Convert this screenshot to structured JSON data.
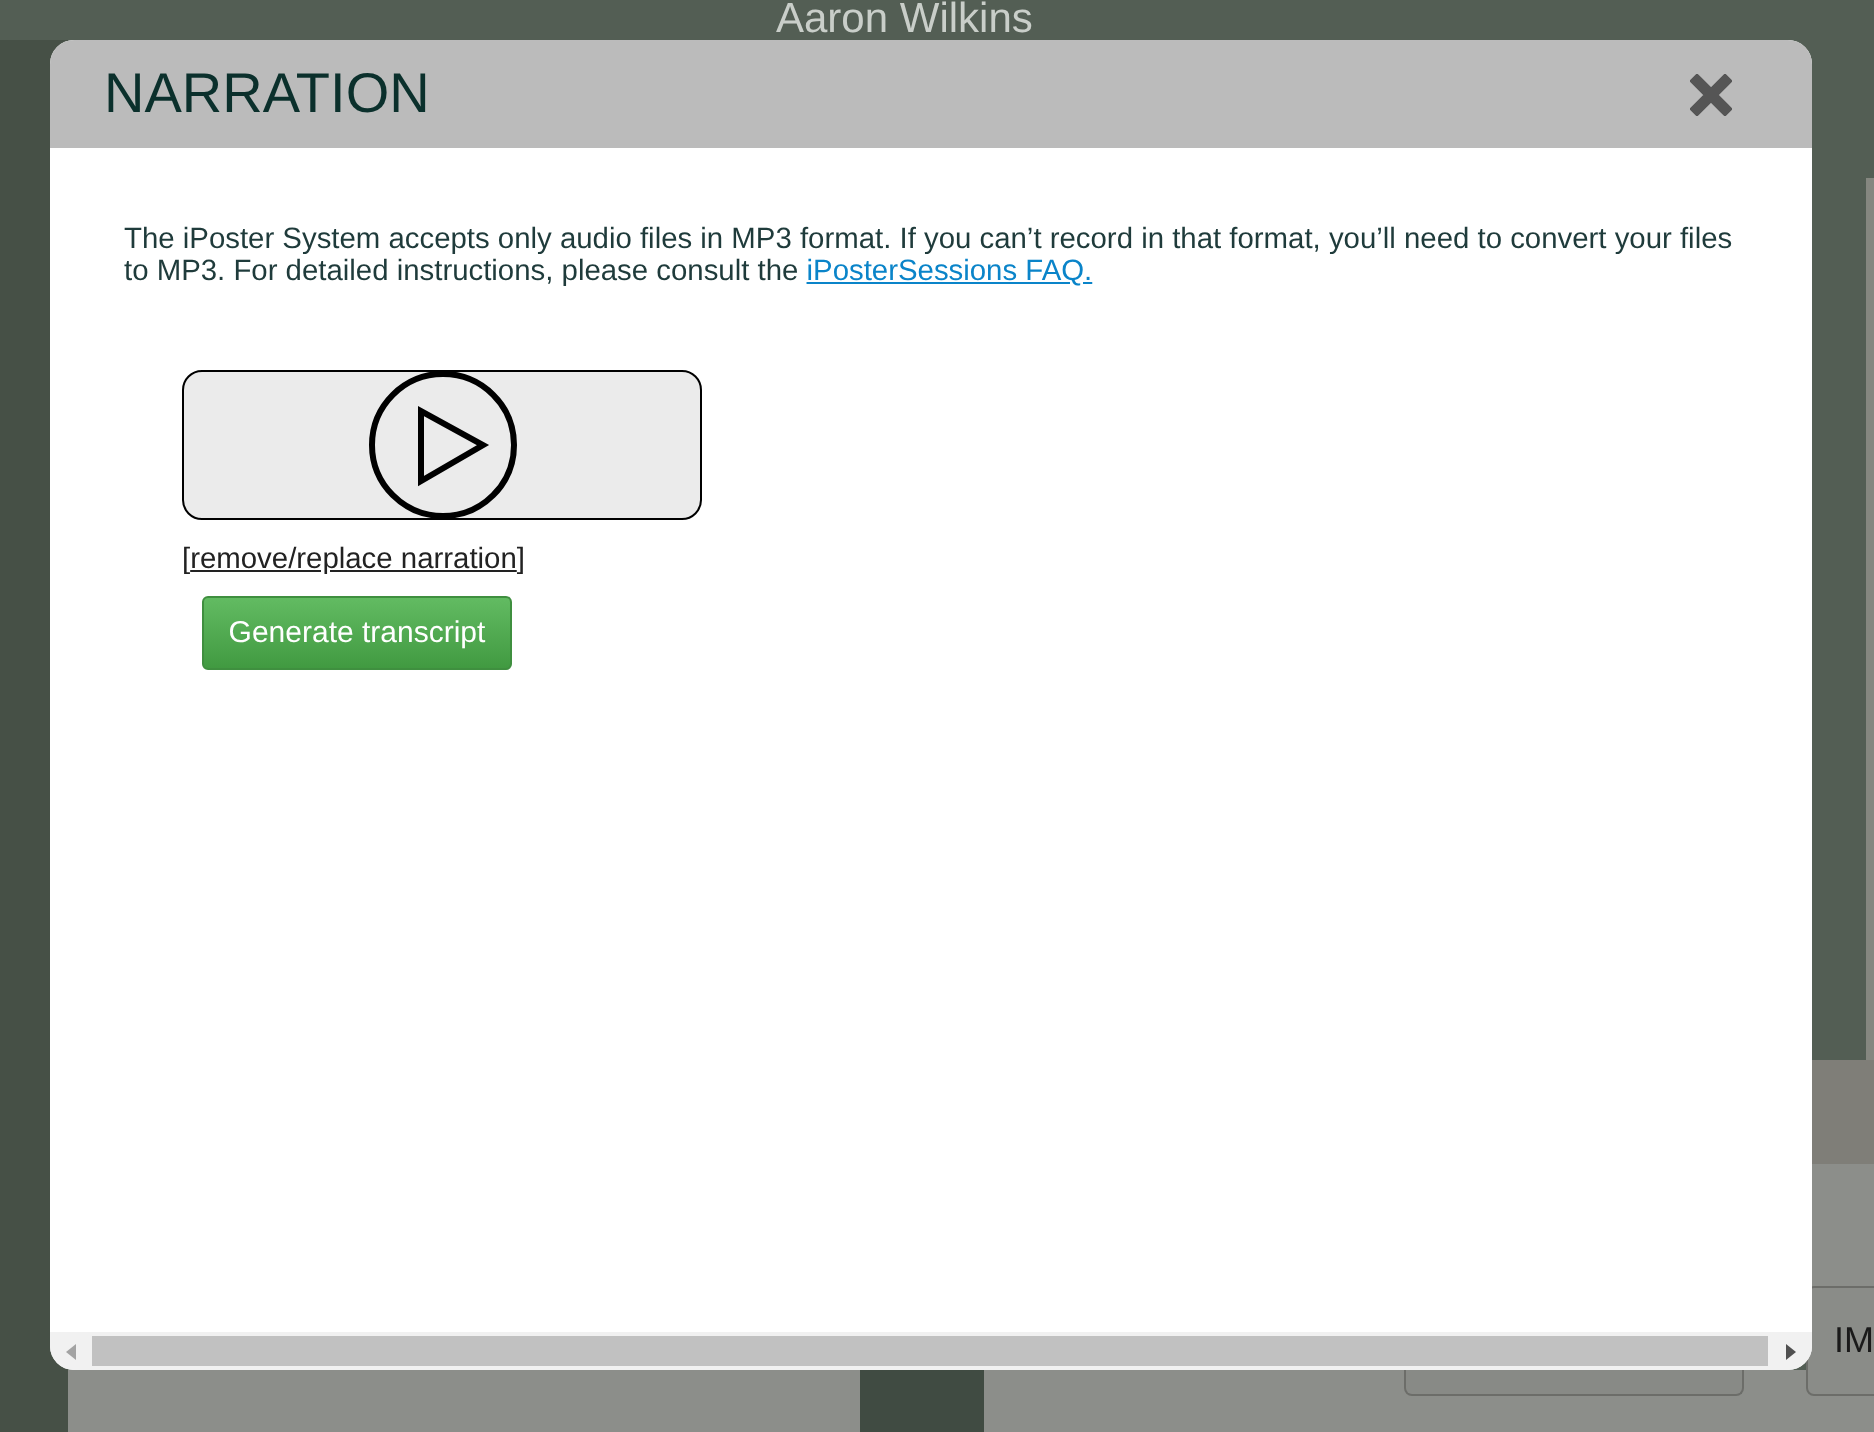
{
  "page_behind": {
    "heading": "Aaron Wilkins",
    "side_button": "IM"
  },
  "dialog": {
    "title": "NARRATION",
    "intro": "The iPoster System accepts only audio files in MP3 format. If you can’t record in that format, you’ll need to convert your files to MP3. For detailed instructions, please consult the ",
    "faq_link": "iPosterSessions FAQ.",
    "remove_link": {
      "before": "[",
      "label": "remove/replace narration",
      "after": "]"
    },
    "transcript_button": "Generate transcript"
  }
}
